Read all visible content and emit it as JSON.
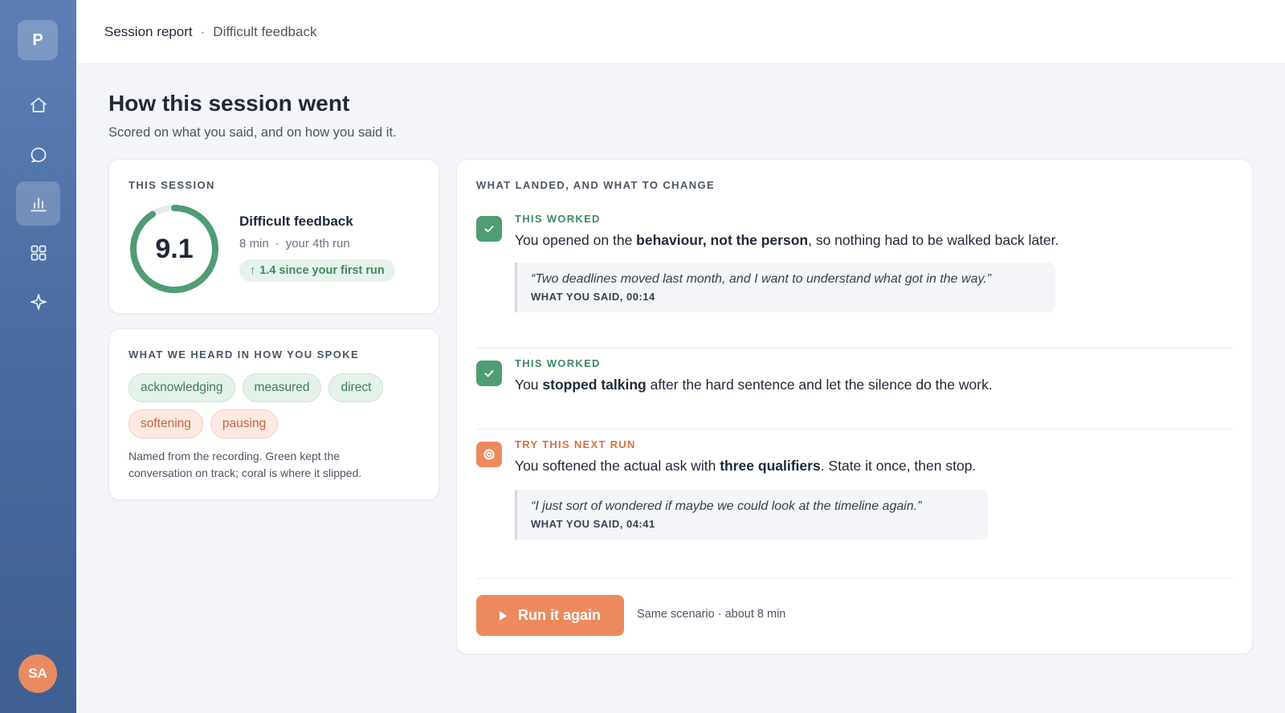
{
  "sidebar": {
    "logo": "P",
    "nav": [
      {
        "name": "home",
        "icon": "home-icon"
      },
      {
        "name": "chat",
        "icon": "chat-icon"
      },
      {
        "name": "reports",
        "icon": "bar-chart-icon",
        "active": true
      },
      {
        "name": "apps",
        "icon": "grid-icon"
      },
      {
        "name": "sparkle",
        "icon": "sparkle-icon"
      }
    ],
    "avatar_initials": "SA"
  },
  "header": {
    "breadcrumb_root": "Session report",
    "breadcrumb_sep": "·",
    "breadcrumb_current": "Difficult feedback"
  },
  "page": {
    "title": "How this session went",
    "subtitle": "Scored on what you said, and on how you said it."
  },
  "session": {
    "eyebrow": "THIS SESSION",
    "score": "9.1",
    "score_fraction": 0.91,
    "title": "Difficult feedback",
    "duration": "8 min",
    "meta_sep": "·",
    "run": "your 4th run",
    "delta": "1.4 since your first run"
  },
  "voice": {
    "eyebrow": "WHAT WE HEARD IN HOW YOU SPOKE",
    "chips_good": [
      "acknowledging",
      "measured",
      "direct"
    ],
    "chips_warn": [
      "softening",
      "pausing"
    ],
    "note": "Named from the recording. Green kept the conversation on track; coral is where it slipped."
  },
  "feedback": {
    "eyebrow": "WHAT LANDED, AND WHAT TO CHANGE",
    "items": [
      {
        "kind": "good",
        "label": "THIS WORKED",
        "text_before": "You opened on the ",
        "text_bold": "behaviour, not the person",
        "text_after": ", so nothing had to be walked back later.",
        "quote": "“Two deadlines moved last month, and I want to understand what got in the way.”",
        "quote_meta": "WHAT YOU SAID, 00:14"
      },
      {
        "kind": "good",
        "label": "THIS WORKED",
        "text_before": "You ",
        "text_bold": "stopped talking",
        "text_after": " after the hard sentence and let the silence do the work."
      },
      {
        "kind": "warn",
        "label": "TRY THIS NEXT RUN",
        "text_before": "You softened the actual ask with ",
        "text_bold": "three qualifiers",
        "text_after": ". State it once, then stop.",
        "quote": "“I just sort of wondered if maybe we could look at the timeline again.”",
        "quote_meta": "WHAT YOU SAID, 04:41"
      }
    ],
    "cta_label": "Run it again",
    "cta_note": "Same scenario · about 8 min"
  },
  "colors": {
    "good": "#4f9d73",
    "warn": "#ec8a5e",
    "sidebar": "#48699e"
  }
}
